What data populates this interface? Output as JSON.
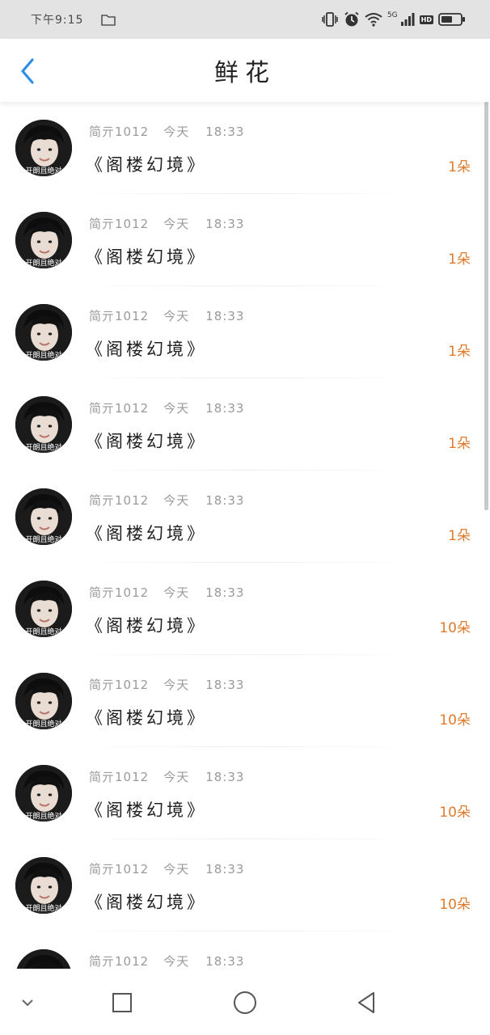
{
  "status_bar": {
    "time": "下午9:15",
    "network": "5G",
    "hd": "HD",
    "icons": [
      "folder-icon",
      "vibrate-icon",
      "alarm-icon",
      "wifi-icon",
      "signal-icon",
      "battery-icon"
    ]
  },
  "header": {
    "title": "鲜花",
    "back_icon": "chevron-left-icon"
  },
  "avatar_caption": "开朗且绝对",
  "items": [
    {
      "user": "简亓1012",
      "day": "今天",
      "time": "18:33",
      "book": "《阁楼幻境》",
      "count": "1朵"
    },
    {
      "user": "简亓1012",
      "day": "今天",
      "time": "18:33",
      "book": "《阁楼幻境》",
      "count": "1朵"
    },
    {
      "user": "简亓1012",
      "day": "今天",
      "time": "18:33",
      "book": "《阁楼幻境》",
      "count": "1朵"
    },
    {
      "user": "简亓1012",
      "day": "今天",
      "time": "18:33",
      "book": "《阁楼幻境》",
      "count": "1朵"
    },
    {
      "user": "简亓1012",
      "day": "今天",
      "time": "18:33",
      "book": "《阁楼幻境》",
      "count": "1朵"
    },
    {
      "user": "简亓1012",
      "day": "今天",
      "time": "18:33",
      "book": "《阁楼幻境》",
      "count": "10朵"
    },
    {
      "user": "简亓1012",
      "day": "今天",
      "time": "18:33",
      "book": "《阁楼幻境》",
      "count": "10朵"
    },
    {
      "user": "简亓1012",
      "day": "今天",
      "time": "18:33",
      "book": "《阁楼幻境》",
      "count": "10朵"
    },
    {
      "user": "简亓1012",
      "day": "今天",
      "time": "18:33",
      "book": "《阁楼幻境》",
      "count": "10朵"
    },
    {
      "user": "简亓1012",
      "day": "今天",
      "time": "18:33",
      "book": "",
      "count": ""
    }
  ],
  "nav_bar": {
    "icons": [
      "chevron-down-icon",
      "recents-square-icon",
      "home-circle-icon",
      "back-triangle-icon"
    ]
  },
  "colors": {
    "accent": "#2f8ee8",
    "count": "#e07b2c",
    "meta": "#9a9a9a"
  }
}
